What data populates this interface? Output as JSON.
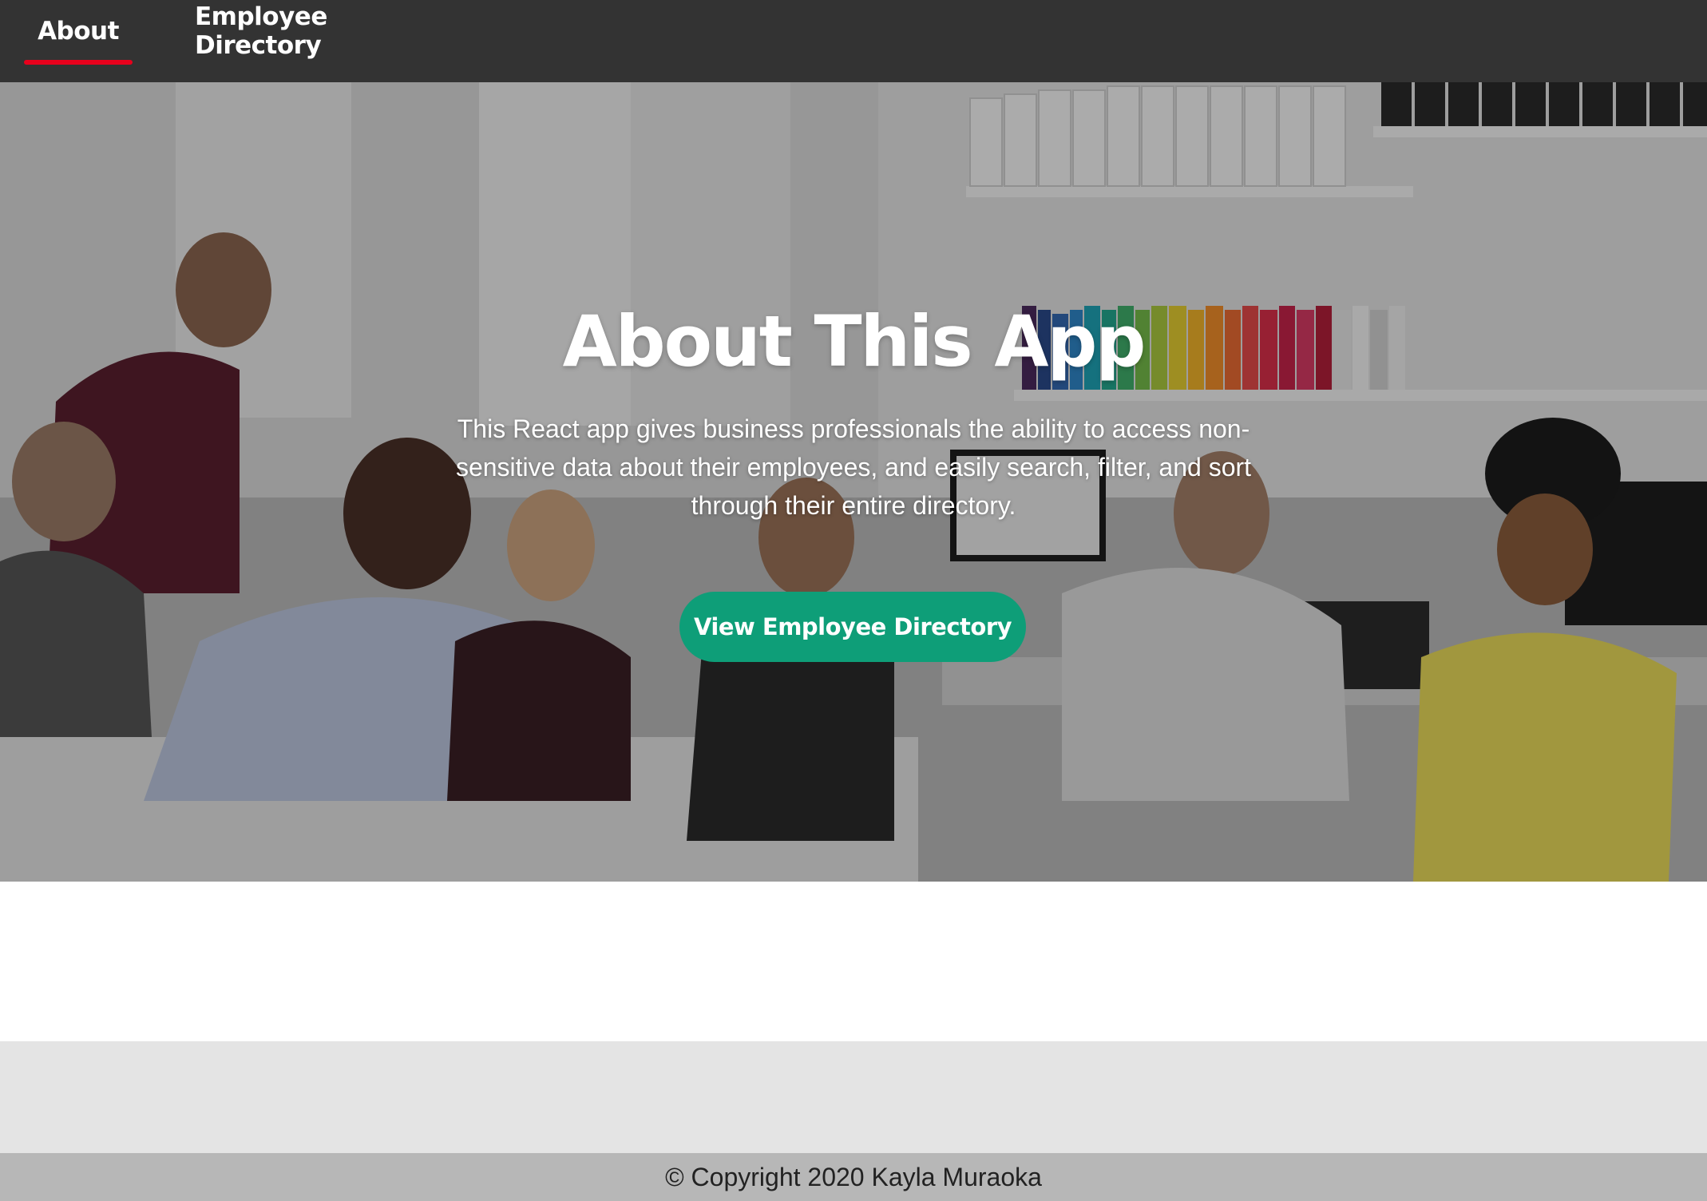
{
  "nav": {
    "items": [
      {
        "label": "About",
        "active": true
      },
      {
        "label": "Employee Directory",
        "active": false
      }
    ],
    "active_indicator_color": "#e8001c",
    "background_color": "#333333"
  },
  "hero": {
    "title": "About This App",
    "description": "This React app gives business professionals the ability to access non-sensitive data about their employees, and easily search, filter, and sort through their entire directory.",
    "button_label": "View Employee Directory",
    "button_color": "#0e9e78",
    "background_image": "office-team-photo"
  },
  "footer": {
    "text": "© Copyright 2020 Kayla Muraoka"
  }
}
